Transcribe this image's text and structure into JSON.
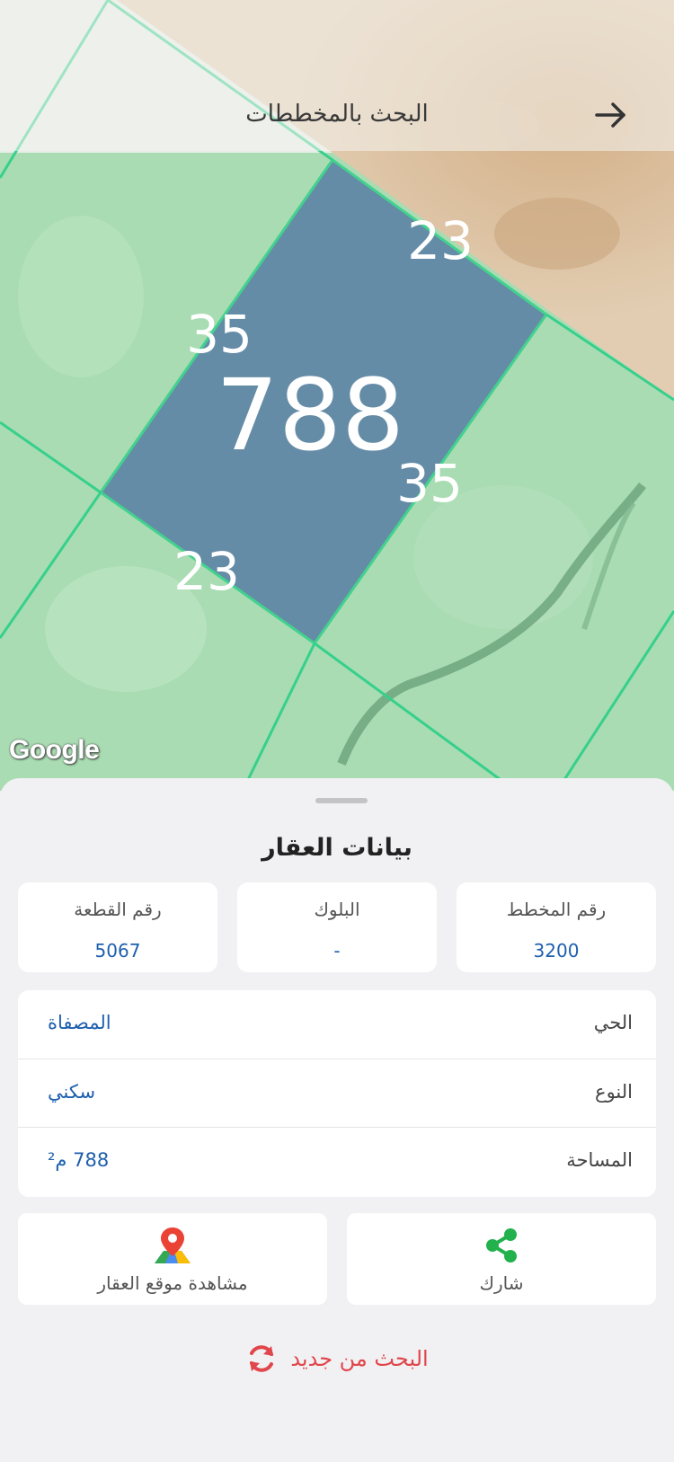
{
  "header": {
    "title": "البحث بالمخططات",
    "back_icon": "arrow-right-icon"
  },
  "map": {
    "parcel_number": "788",
    "edge_top": "23",
    "edge_bottom": "23",
    "edge_left": "35",
    "edge_right": "35",
    "attribution": "Google"
  },
  "sheet": {
    "title": "بيانات العقار",
    "cards": [
      {
        "label": "رقم المخطط",
        "value": "3200"
      },
      {
        "label": "البلوك",
        "value": "-"
      },
      {
        "label": "رقم القطعة",
        "value": "5067"
      }
    ],
    "details": [
      {
        "key": "الحي",
        "value": "المصفاة"
      },
      {
        "key": "النوع",
        "value": "سكني"
      },
      {
        "key": "المساحة",
        "value": "788 م²"
      }
    ],
    "actions": {
      "share_label": "شارك",
      "share_icon": "share-icon",
      "location_label": "مشاهدة موقع العقار",
      "location_icon": "map-pin-icon"
    },
    "research_label": "البحث من جديد",
    "research_icon": "refresh-icon"
  },
  "colors": {
    "accent": "#1e5fae",
    "danger": "#e0464b",
    "share_green": "#22b14c",
    "parcel_fill": "#5c82a6"
  }
}
